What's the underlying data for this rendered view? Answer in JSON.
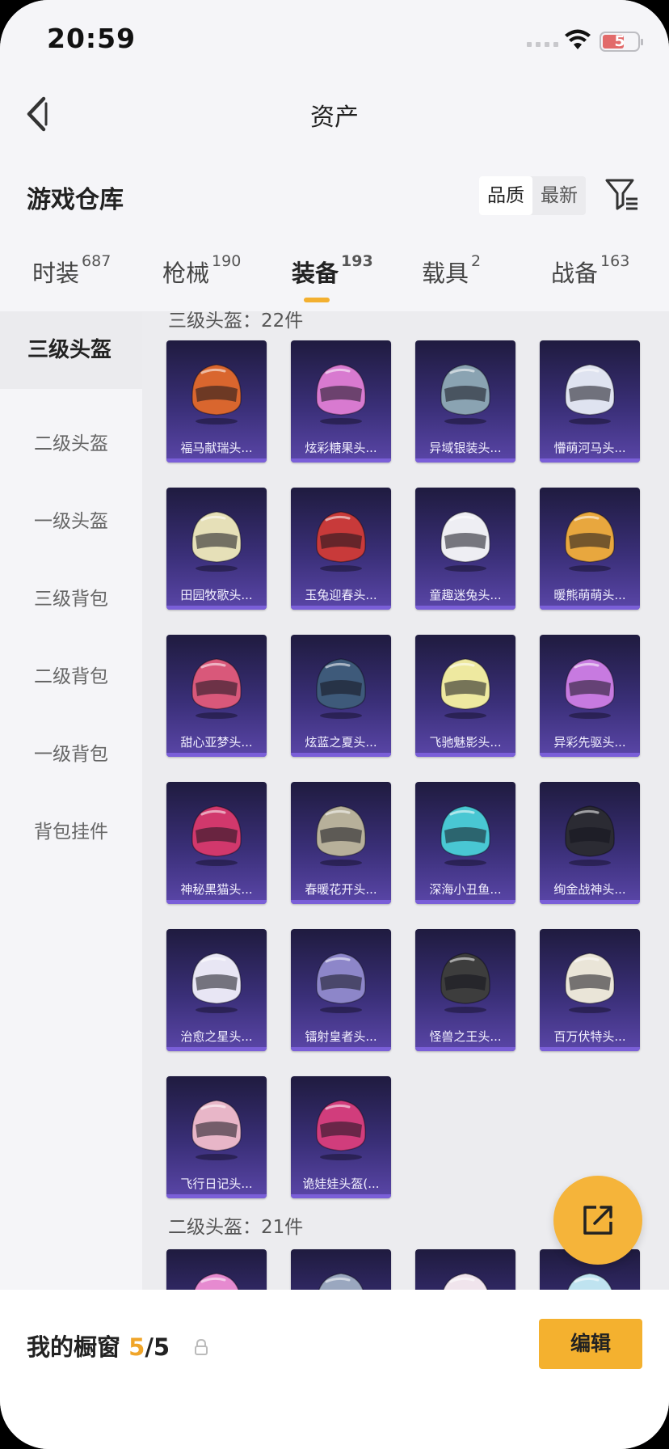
{
  "status_bar": {
    "time": "20:59",
    "battery": "5"
  },
  "header": {
    "title": "资产"
  },
  "warehouse": {
    "title": "游戏仓库",
    "sort_options": [
      "品质",
      "最新"
    ],
    "sort_selected": "品质"
  },
  "tabs": [
    {
      "label": "时装",
      "count": "687"
    },
    {
      "label": "枪械",
      "count": "190"
    },
    {
      "label": "装备",
      "count": "193",
      "active": true
    },
    {
      "label": "载具",
      "count": "2"
    },
    {
      "label": "战备",
      "count": "163"
    }
  ],
  "sidebar": {
    "items": [
      "三级头盔",
      "二级头盔",
      "一级头盔",
      "三级背包",
      "二级背包",
      "一级背包",
      "背包挂件"
    ],
    "active": "三级头盔"
  },
  "sections": [
    {
      "heading": "三级头盔：22件",
      "items": [
        "福马献瑞头...",
        "炫彩糖果头...",
        "异域银装头...",
        "懵萌河马头...",
        "田园牧歌头...",
        "玉兔迎春头...",
        "童趣迷兔头...",
        "暖熊萌萌头...",
        "甜心亚梦头...",
        "炫蓝之夏头...",
        "飞驰魅影头...",
        "异彩先驱头...",
        "神秘黑猫头...",
        "春暖花开头...",
        "深海小丑鱼...",
        "绚金战神头...",
        "治愈之星头...",
        "镭射皇者头...",
        "怪兽之王头...",
        "百万伏特头...",
        "飞行日记头...",
        "诡娃娃头盔(..."
      ]
    },
    {
      "heading": "二级头盔：21件",
      "items": []
    }
  ],
  "item_colors": [
    "#d9662e",
    "#d87ad0",
    "#8aa3b2",
    "#dfe3f0",
    "#e6e0b8",
    "#c83a3a",
    "#eeeef3",
    "#e8a73e",
    "#d9587a",
    "#3e5a7a",
    "#eee9a0",
    "#c77ae0",
    "#d1386c",
    "#b7b09a",
    "#49c7d3",
    "#2b2b33",
    "#e8e6f4",
    "#8d86c9",
    "#3d3d3d",
    "#eae5d8",
    "#e8b6c8",
    "#d13d7c"
  ],
  "footer": {
    "label": "我的橱窗",
    "current": "5",
    "total": "5",
    "edit_label": "编辑"
  }
}
